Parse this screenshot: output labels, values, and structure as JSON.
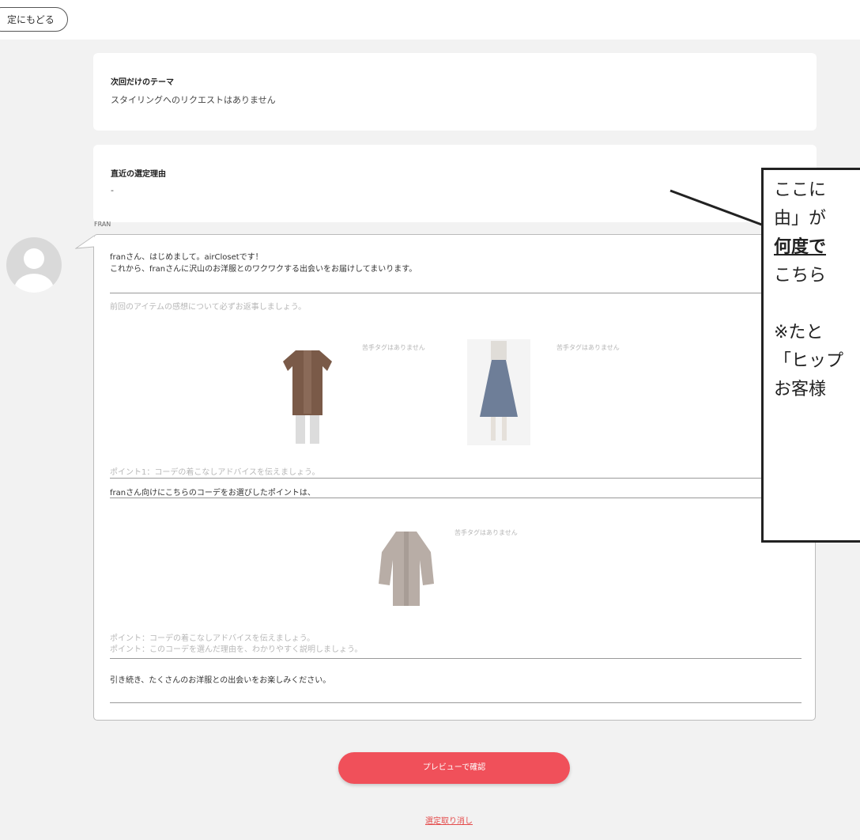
{
  "topbar": {
    "back_label": "定にもどる"
  },
  "theme_card": {
    "title": "次回だけのテーマ",
    "body": "スタイリングへのリクエストはありません"
  },
  "reason_card": {
    "title": "直近の選定理由",
    "body": "-"
  },
  "chat": {
    "sender": "FRAN",
    "greeting_line1": "franさん、はじめまして。airClosetです！",
    "greeting_line2": "これから、franさんに沢山のお洋服とのワクワクする出会いをお届けしてまいります。",
    "feedback_placeholder": "前回のアイテムの感想について必ずお返事しましょう。",
    "item_tag": "苦手タグはありません",
    "point1_placeholder": "ポイント1：コーデの着こなしアドバイスを伝えましょう。",
    "point1_text": "franさん向けにこちらのコーデをお選びしたポイントは、",
    "point2_placeholder_line1": "ポイント：コーデの着こなしアドバイスを伝えましょう。",
    "point2_placeholder_line2": "ポイント：このコーデを選んだ理由を、わかりやすく説明しましょう。",
    "closing_text": "引き続き、たくさんのお洋服との出会いをお楽しみください。"
  },
  "actions": {
    "preview_label": "プレビューで確認",
    "cancel_label": "選定取り消し"
  },
  "annotation": {
    "line1": "ここに",
    "line2": "由」が",
    "line3_bold": "何度で",
    "line4": "こちら",
    "line5": "※たと",
    "line6": "「ヒップ",
    "line7": "お客様"
  },
  "colors": {
    "accent": "#f0505a",
    "background": "#f2f2f2"
  }
}
